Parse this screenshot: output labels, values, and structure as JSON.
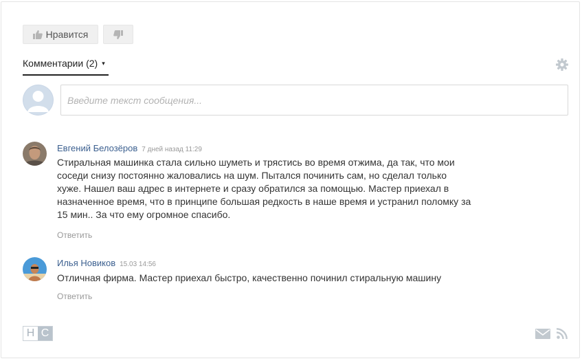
{
  "reactions": {
    "like_label": "Нравится",
    "like_icon": "thumbs-up-icon",
    "dislike_icon": "thumbs-down-icon"
  },
  "comments_tab": {
    "label": "Комментарии (2)",
    "caret": "▾"
  },
  "settings_icon": "gear-icon",
  "compose": {
    "placeholder": "Введите текст сообщения..."
  },
  "comments": [
    {
      "author": "Евгений Белозёров",
      "date": "7 дней назад 11:29",
      "lines": [
        "Стиральная машинка стала сильно шуметь и трястись во время отжима, да так, что мои",
        "соседи снизу постоянно жаловались на шум. Пытался починить сам, но сделал только",
        "хуже. Нашел ваш адрес в интернете и сразу обратился за помощью. Мастер приехал в",
        "назначенное время, что в принципе большая редкость в наше время и устранил поломку за",
        "15 мин.. За что ему огромное спасибо."
      ],
      "reply_label": "Ответить"
    },
    {
      "author": "Илья Новиков",
      "date": "15.03 14:56",
      "lines": [
        "Отличная фирма. Мастер приехал быстро, качественно починил стиральную машину"
      ],
      "reply_label": "Ответить"
    }
  ],
  "footer": {
    "brand_letters": [
      "Н",
      "С"
    ],
    "mail_icon": "envelope-icon",
    "rss_icon": "rss-icon"
  },
  "colors": {
    "author_link": "#3b5f8f",
    "muted": "#999999",
    "button_bg": "#f0f0f0"
  }
}
